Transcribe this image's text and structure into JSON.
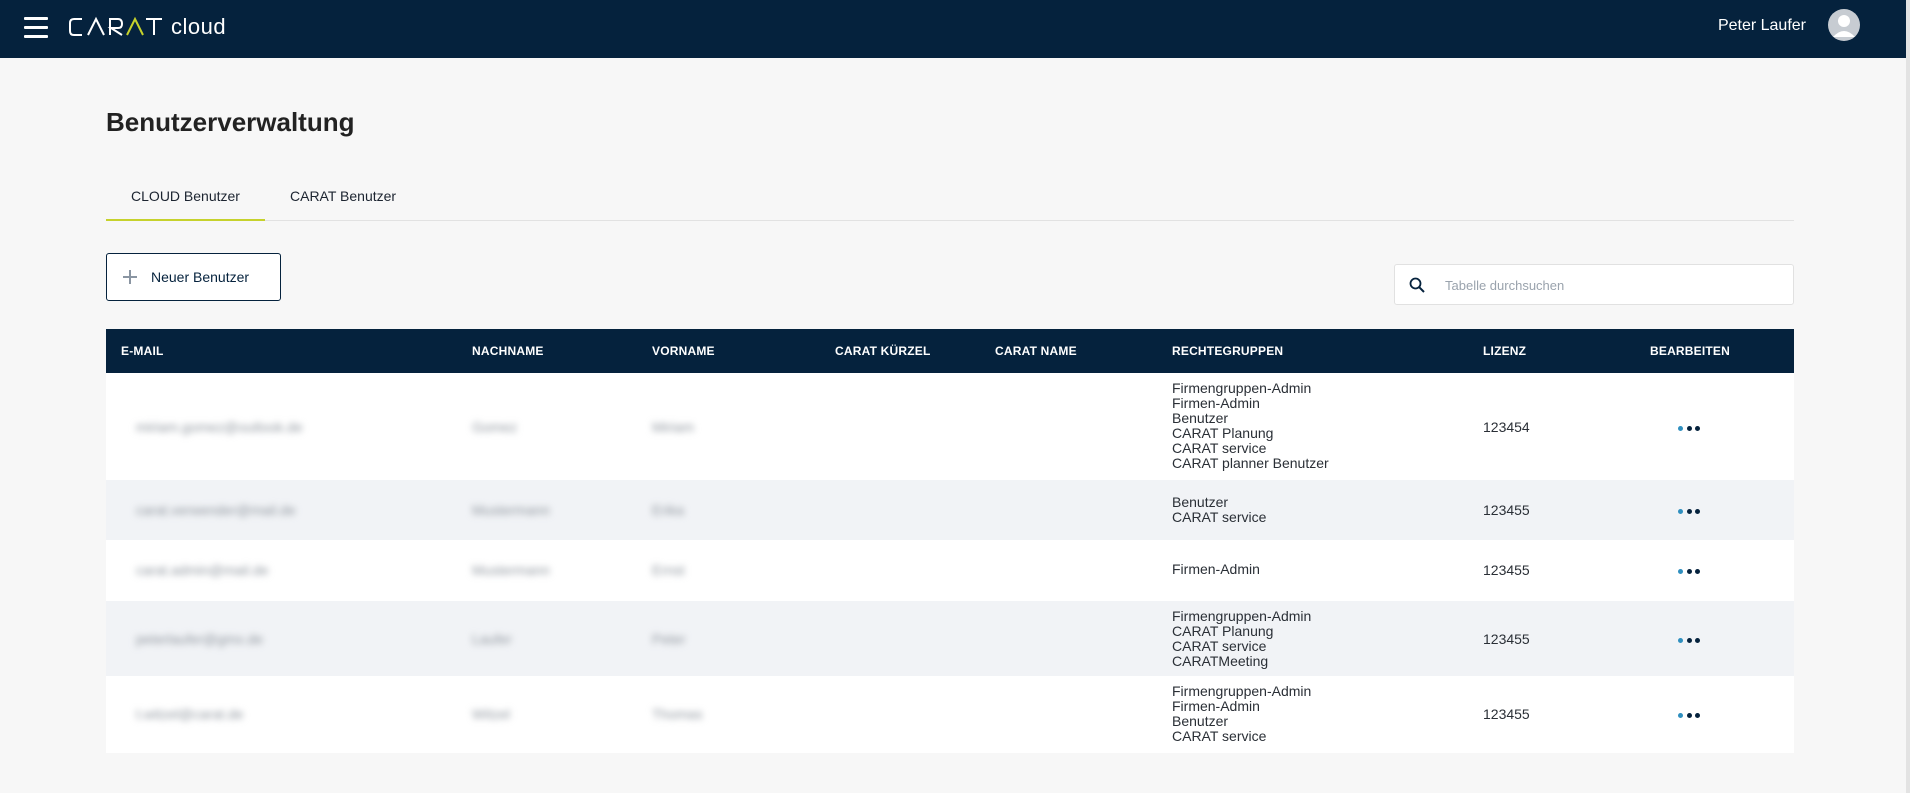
{
  "app": {
    "brand": "CARAT",
    "brand_suffix": "cloud",
    "user_name": "Peter Laufer"
  },
  "page": {
    "title": "Benutzerverwaltung",
    "tabs": [
      {
        "label": "CLOUD Benutzer",
        "active": true
      },
      {
        "label": "CARAT Benutzer",
        "active": false
      }
    ],
    "new_user_label": "Neuer Benutzer",
    "search_placeholder": "Tabelle durchsuchen"
  },
  "table": {
    "headers": [
      "E-MAIL",
      "NACHNAME",
      "VORNAME",
      "CARAT KÜRZEL",
      "CARAT NAME",
      "RECHTEGRUPPEN",
      "LIZENZ",
      "BEARBEITEN"
    ],
    "rows": [
      {
        "email": "miriam.gomez@outlook.de",
        "last": "Gomez",
        "first": "Miriam",
        "groups": [
          "Firmengruppen-Admin",
          "Firmen-Admin",
          "Benutzer",
          "CARAT Planung",
          "CARAT service",
          "CARAT planner Benutzer"
        ],
        "license": "123454"
      },
      {
        "email": "carat.verwender@mail.de",
        "last": "Mustermann",
        "first": "Erika",
        "groups": [
          "Benutzer",
          "CARAT service"
        ],
        "license": "123455"
      },
      {
        "email": "carat.admin@mail.de",
        "last": "Mustermann",
        "first": "Ernst",
        "groups": [
          "Firmen-Admin"
        ],
        "license": "123455"
      },
      {
        "email": "peterlaufer@gmx.de",
        "last": "Laufer",
        "first": "Peter",
        "groups": [
          "Firmengruppen-Admin",
          "CARAT Planung",
          "CARAT service",
          "CARATMeeting"
        ],
        "license": "123455"
      },
      {
        "email": "t.witzel@carat.de",
        "last": "Witzel",
        "first": "Thomas",
        "groups": [
          "Firmengruppen-Admin",
          "Firmen-Admin",
          "Benutzer",
          "CARAT service"
        ],
        "license": "123455"
      }
    ]
  },
  "colors": {
    "navy": "#05223d",
    "accent_lime": "#c6d22c",
    "row_stripe": "#f1f3f6",
    "page_bg": "#f7f7f7"
  },
  "icons": {
    "menu": "hamburger-icon",
    "user": "user-avatar-icon",
    "add": "plus-icon",
    "search": "search-icon",
    "actions": "more-horizontal-icon"
  }
}
